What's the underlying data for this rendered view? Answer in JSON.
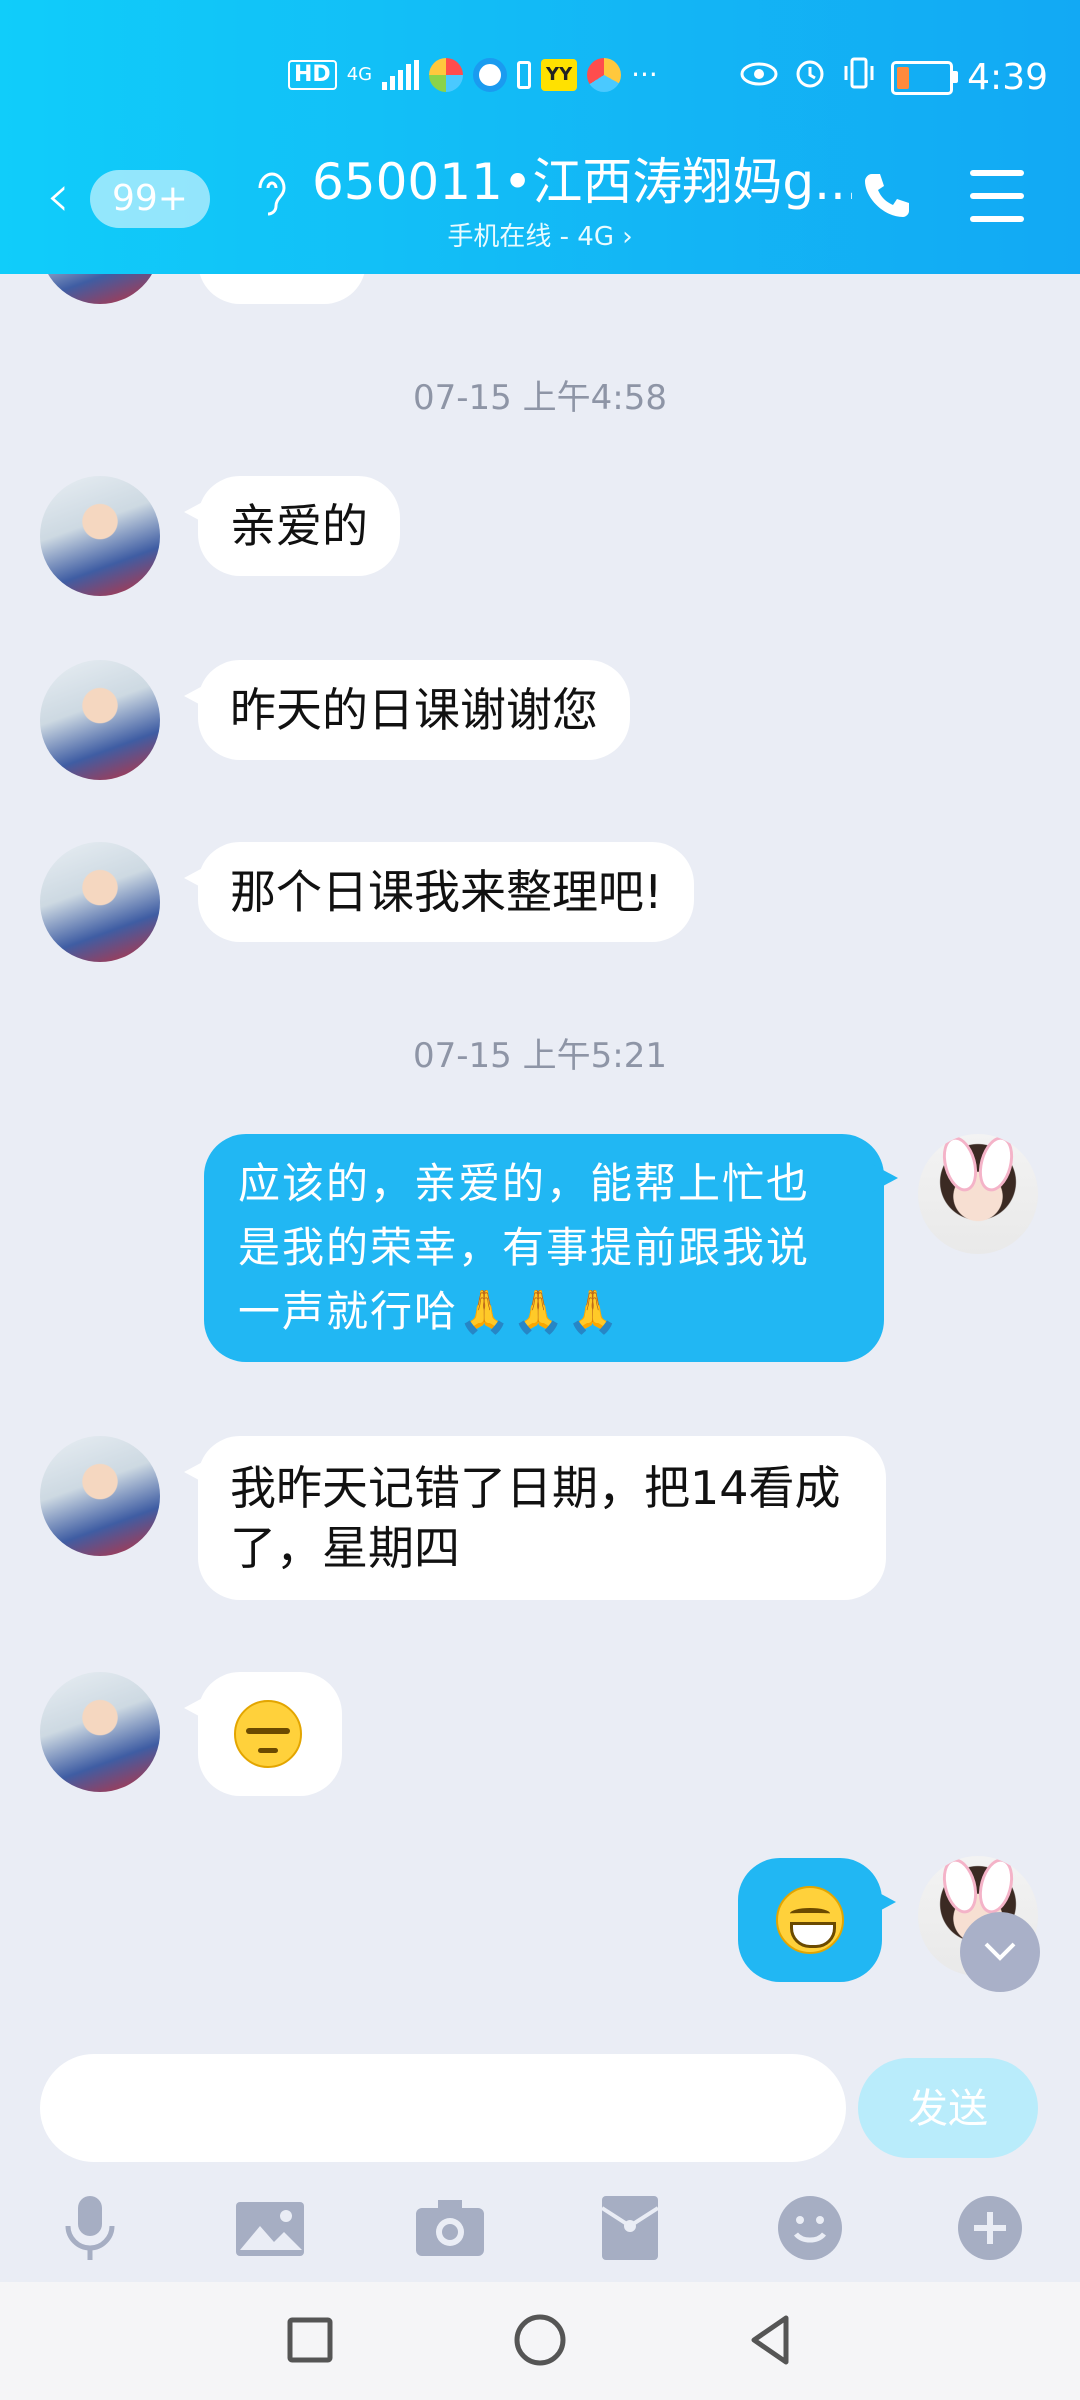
{
  "status_bar": {
    "left_badges": [
      "HD",
      "4G"
    ],
    "yy_label": "YY",
    "more": "···",
    "time": "4:39"
  },
  "header": {
    "unread_count": "99+",
    "title": "650011•江西涛翔妈g...",
    "subtitle": "手机在线 - 4G ›"
  },
  "messages": [
    {
      "type": "timestamp",
      "text": "07-15 上午4:58"
    },
    {
      "type": "in",
      "text": "亲爱的"
    },
    {
      "type": "in",
      "text": "昨天的日课谢谢您"
    },
    {
      "type": "in",
      "text": "那个日课我来整理吧!"
    },
    {
      "type": "timestamp",
      "text": "07-15 上午5:21"
    },
    {
      "type": "out",
      "text": "应该的，亲爱的，能帮上忙也是我的荣幸，有事提前跟我说一声就行哈",
      "emoji_tail": "🙏🙏🙏"
    },
    {
      "type": "in",
      "text": "我昨天记错了日期，把14看成了，星期四"
    },
    {
      "type": "in",
      "emoji": "sweat-emoji"
    },
    {
      "type": "out",
      "emoji": "grin-emoji"
    }
  ],
  "input": {
    "placeholder": "",
    "send_label": "发送"
  },
  "toolbar": [
    "voice",
    "image",
    "camera",
    "red-packet",
    "emoji",
    "more"
  ],
  "colors": {
    "header_gradient_start": "#10cdfa",
    "header_gradient_end": "#12a9f4",
    "outgoing_bubble": "#21b7f3",
    "incoming_bubble": "#ffffff",
    "chat_background": "#eaedf5",
    "send_button": "#b9ecfb"
  }
}
